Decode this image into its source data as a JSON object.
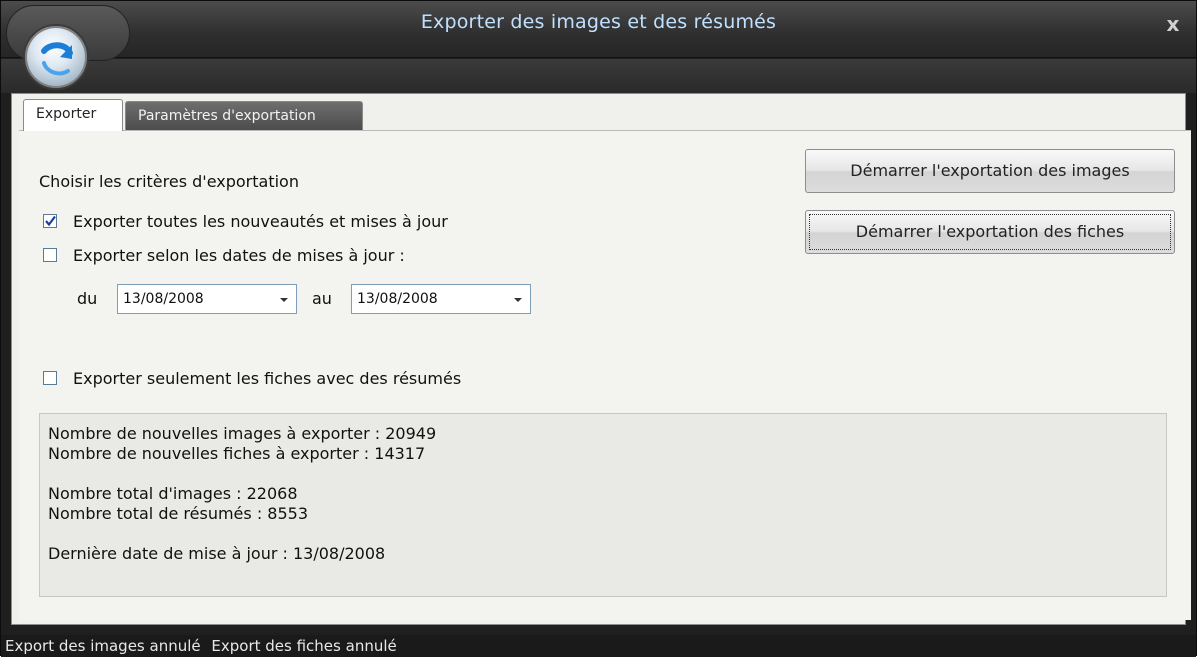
{
  "window": {
    "title": "Exporter des images et des résumés",
    "close_glyph": "x",
    "app_icon": "circular-arrow-icon"
  },
  "tabs": [
    {
      "label": "Exporter",
      "active": true
    },
    {
      "label": "Paramètres d'exportation",
      "active": false
    }
  ],
  "criteria": {
    "heading": "Choisir les critères d'exportation",
    "options": [
      {
        "label": "Exporter toutes les nouveautés et mises à jour",
        "checked": true
      },
      {
        "label": "Exporter selon les dates de mises à jour :",
        "checked": false
      }
    ],
    "date_from_label": "du",
    "date_from_value": "13/08/2008",
    "date_to_label": "au",
    "date_to_value": "13/08/2008",
    "summaries_only": {
      "label": "Exporter seulement les fiches avec des résumés",
      "checked": false
    }
  },
  "buttons": {
    "export_images": "Démarrer l'exportation des images",
    "export_records": "Démarrer l'exportation des fiches"
  },
  "info": {
    "new_images": "Nombre de nouvelles images à exporter : 20949",
    "new_records": "Nombre de nouvelles fiches à exporter : 14317",
    "total_images": "Nombre total d'images : 22068",
    "total_summaries": "Nombre total de résumés : 8553",
    "last_update": "Dernière date de mise à jour : 13/08/2008"
  },
  "status": {
    "images": "Export des images annulé",
    "records": "Export des fiches annulé"
  },
  "colors": {
    "title_text": "#bfe0ff",
    "frame": "#1f1f1f",
    "content_bg": "#f3f3ef"
  }
}
